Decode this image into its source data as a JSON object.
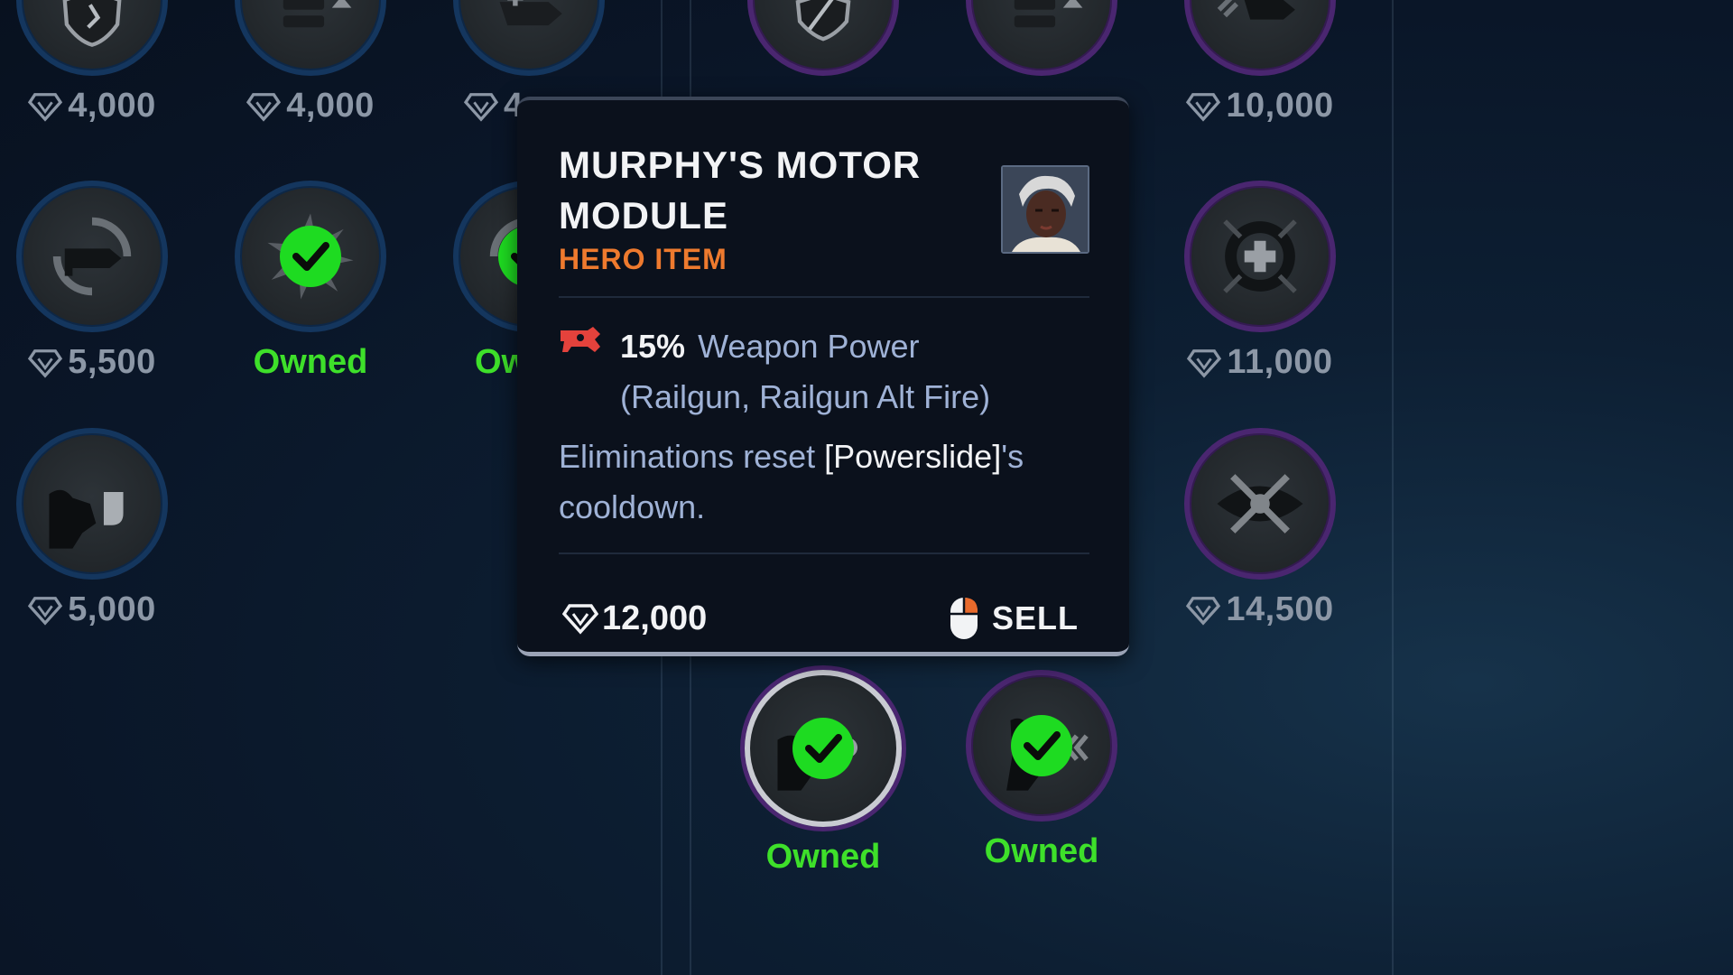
{
  "colors": {
    "owned": "#3ee02a",
    "hero_item": "#ee7a2e",
    "price_muted": "#8c97a6",
    "ring_blue": "#14365e",
    "ring_purple": "#4a2670"
  },
  "left_column": {
    "row1": [
      {
        "icon": "shield-break-icon",
        "price": "4,000"
      },
      {
        "icon": "ammo-upgrade-icon",
        "price": "4,000"
      },
      {
        "icon": "gun-heal-icon",
        "price": "4"
      }
    ],
    "row2": [
      {
        "icon": "reload-gun-icon",
        "price": "5,500"
      },
      {
        "icon": "burst-ability-icon",
        "status": "Owned"
      },
      {
        "icon": "cooldown-icon",
        "status": "Ow"
      }
    ],
    "row3": [
      {
        "icon": "hero-punch-icon",
        "price": "5,000"
      }
    ]
  },
  "right_column": {
    "row1": [
      {
        "icon": "shield-slash-icon"
      },
      {
        "icon": "ammo-upgrade-icon"
      },
      {
        "icon": "weapon-speed-icon",
        "price": "10,000"
      }
    ],
    "row2": [
      {
        "icon": "health-cross-icon",
        "price": "11,000"
      }
    ],
    "row3": [
      {
        "icon": "blade-cross-icon",
        "price": "14,500"
      }
    ],
    "row4": [
      {
        "icon": "hero-skull-icon",
        "status": "Owned"
      },
      {
        "icon": "hero-dash-icon",
        "status": "Owned"
      }
    ]
  },
  "tooltip": {
    "title": "MURPHY'S MOTOR MODULE",
    "type": "HERO ITEM",
    "stat_value": "15%",
    "stat_name": "Weapon Power",
    "stat_detail": "(Railgun, Railgun Alt Fire)",
    "desc_pre": "Eliminations reset ",
    "desc_keyword": "[Powerslide]",
    "desc_post": "'s cooldown.",
    "price": "12,000",
    "sell_label": "SELL"
  }
}
